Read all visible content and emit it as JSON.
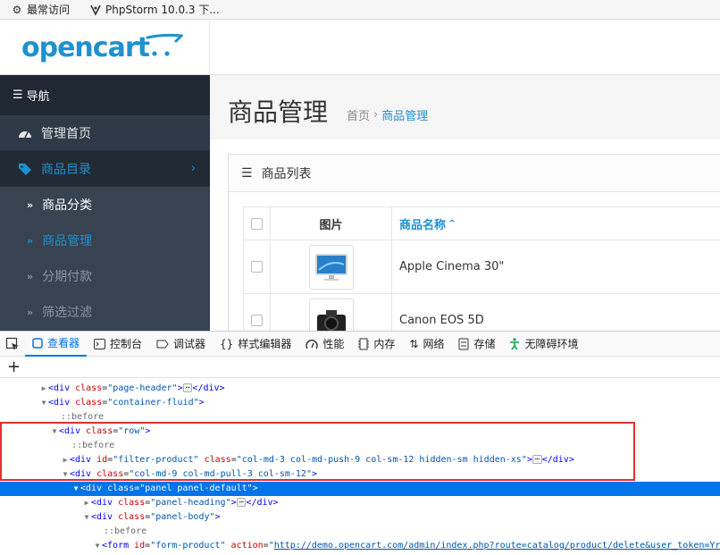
{
  "bookmarks": [
    {
      "icon": "gear-icon",
      "label": "最常访问"
    },
    {
      "icon": "phpstorm-icon",
      "label": "PhpStorm 10.0.3 下..."
    }
  ],
  "logo": {
    "text": "opencart",
    "brand_color": "#1e91cf"
  },
  "sidebar": {
    "title": "导航",
    "items": [
      {
        "label": "管理首页",
        "icon": "dashboard-icon"
      },
      {
        "label": "商品目录",
        "icon": "tag-icon",
        "active": true
      }
    ],
    "sub_items": [
      {
        "label": "商品分类"
      },
      {
        "label": "商品管理",
        "current": true
      },
      {
        "label": "分期付款"
      },
      {
        "label": "筛选过滤"
      }
    ]
  },
  "page": {
    "title": "商品管理",
    "breadcrumb": {
      "home": "首页",
      "sep": "›",
      "current": "商品管理"
    }
  },
  "panel": {
    "heading": "商品列表",
    "columns": {
      "image": "图片",
      "name": "商品名称"
    },
    "rows": [
      {
        "name": "Apple Cinema 30\""
      },
      {
        "name": "Canon EOS 5D"
      }
    ]
  },
  "devtools": {
    "tabs": [
      {
        "label": "查看器",
        "icon": "inspector-icon",
        "active": true
      },
      {
        "label": "控制台",
        "icon": "console-icon"
      },
      {
        "label": "调试器",
        "icon": "debugger-icon"
      },
      {
        "label": "样式编辑器",
        "icon": "style-editor-icon"
      },
      {
        "label": "性能",
        "icon": "performance-icon"
      },
      {
        "label": "内存",
        "icon": "memory-icon"
      },
      {
        "label": "网络",
        "icon": "network-icon"
      },
      {
        "label": "存储",
        "icon": "storage-icon"
      },
      {
        "label": "无障碍环境",
        "icon": "accessibility-icon"
      }
    ],
    "highlight_color": "#e0302f",
    "dom": {
      "l1_tag": "div",
      "l1_class": "page-header",
      "l2_tag": "div",
      "l2_class": "container-fluid",
      "before": "::before",
      "row_class": "row",
      "filter_id": "filter-product",
      "filter_class": "col-md-3 col-md-push-9 col-sm-12 hidden-sm hidden-xs",
      "col_class": "col-md-9 col-md-pull-3 col-sm-12",
      "panel_class": "panel panel-default",
      "heading_class": "panel-heading",
      "body_class": "panel-body",
      "form_id": "form-product",
      "form_action": "http://demo.opencart.com/admin/index.php?route=catalog/product/delete&user_token=YrG"
    }
  }
}
